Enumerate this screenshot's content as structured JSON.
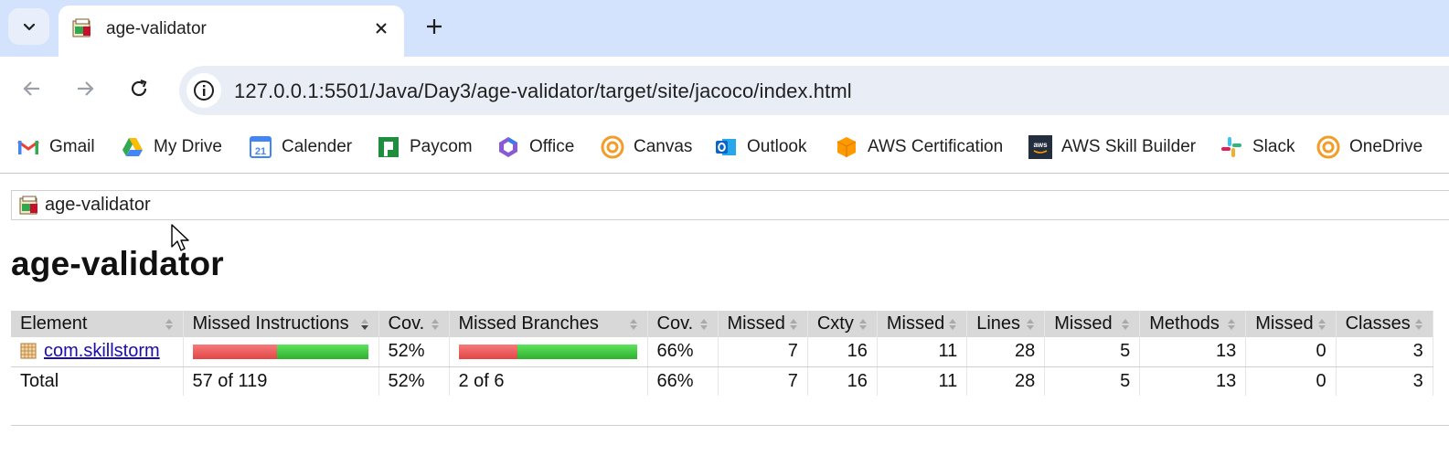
{
  "browser": {
    "tab": {
      "title": "age-validator"
    },
    "url": "127.0.0.1:5501/Java/Day3/age-validator/target/site/jacoco/index.html",
    "bookmarks": [
      {
        "label": "Gmail",
        "icon": "gmail-icon"
      },
      {
        "label": "My Drive",
        "icon": "drive-icon"
      },
      {
        "label": "Calender",
        "icon": "calendar-icon"
      },
      {
        "label": "Paycom",
        "icon": "paycom-icon"
      },
      {
        "label": "Office",
        "icon": "office-icon"
      },
      {
        "label": "Canvas",
        "icon": "canvas-icon"
      },
      {
        "label": "Outlook",
        "icon": "outlook-icon"
      },
      {
        "label": "AWS Certification",
        "icon": "aws-certification-icon"
      },
      {
        "label": "AWS Skill Builder",
        "icon": "aws-icon"
      },
      {
        "label": "Slack",
        "icon": "slack-icon"
      },
      {
        "label": "OneDrive",
        "icon": "canvas-icon"
      }
    ]
  },
  "report": {
    "breadcrumb": "age-validator",
    "title": "age-validator",
    "headers": [
      "Element",
      "Missed Instructions",
      "Cov.",
      "Missed Branches",
      "Cov.",
      "Missed",
      "Cxty",
      "Missed",
      "Lines",
      "Missed",
      "Methods",
      "Missed",
      "Classes"
    ],
    "rows": [
      {
        "element": "com.skillstorm",
        "instructions_missed_fraction": 0.48,
        "instructions_cov": "52%",
        "branches_missed_fraction": 0.33,
        "branches_cov": "66%",
        "cxty_missed": "7",
        "cxty": "16",
        "lines_missed": "11",
        "lines": "28",
        "methods_missed": "5",
        "methods": "13",
        "classes_missed": "0",
        "classes": "3"
      }
    ],
    "total": {
      "label": "Total",
      "instructions": "57 of 119",
      "instructions_cov": "52%",
      "branches": "2 of 6",
      "branches_cov": "66%",
      "cxty_missed": "7",
      "cxty": "16",
      "lines_missed": "11",
      "lines": "28",
      "methods_missed": "5",
      "methods": "13",
      "classes_missed": "0",
      "classes": "3"
    }
  },
  "colors": {
    "coverage_missed": "#e24646",
    "coverage_covered": "#2fb02f",
    "link": "#1a0dab",
    "tabstrip": "#d3e3fd"
  }
}
